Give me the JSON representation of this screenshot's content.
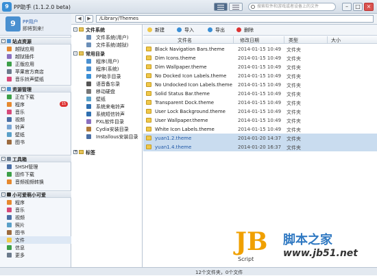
{
  "app": {
    "icon_glyph": "9",
    "title": "PP助手 (1.1.2.0 beta)"
  },
  "search": {
    "placeholder": "搜索软件和游戏或者设备上的文件"
  },
  "window_buttons": {
    "minimize": "–",
    "maximize": "□",
    "close": "×"
  },
  "profile": {
    "avatar_glyph": "9",
    "name": "PP用户",
    "slogan": "即将到来！"
  },
  "sidebar": {
    "sections": [
      {
        "label": "站点资源",
        "items": [
          {
            "label": "越狱应用"
          },
          {
            "label": "越狱插件"
          },
          {
            "label": "正版应用"
          },
          {
            "label": "苹果官方商店"
          },
          {
            "label": "音乐铃声壁纸"
          }
        ]
      },
      {
        "label": "资源管理",
        "items": [
          {
            "label": "正在下载"
          },
          {
            "label": "程序",
            "badge": "15"
          },
          {
            "label": "音乐"
          },
          {
            "label": "视频"
          },
          {
            "label": "铃声"
          },
          {
            "label": "壁纸"
          },
          {
            "label": "图书"
          }
        ]
      },
      {
        "label": "工具箱",
        "items": [
          {
            "label": "SHSH管理"
          },
          {
            "label": "固件下载"
          },
          {
            "label": "音频视频转换"
          }
        ]
      },
      {
        "label": "小可爱萌小可爱",
        "items": [
          {
            "label": "程序"
          },
          {
            "label": "音乐"
          },
          {
            "label": "视频"
          },
          {
            "label": "照片"
          },
          {
            "label": "图书"
          },
          {
            "label": "文件"
          },
          {
            "label": "信息"
          },
          {
            "label": "更多"
          }
        ]
      }
    ]
  },
  "toolbar": {
    "back": "◀",
    "forward": "▶",
    "path": "/Library/Themes"
  },
  "tree": {
    "groups": [
      {
        "label": "文件系统",
        "items": [
          {
            "label": "文件系统(用户)"
          },
          {
            "label": "文件系统(越狱)"
          }
        ]
      },
      {
        "label": "常用目录",
        "items": [
          {
            "label": "程序(用户)"
          },
          {
            "label": "程序(系统)"
          },
          {
            "label": "PP助手目录"
          },
          {
            "label": "语音备忘录"
          },
          {
            "label": "移动硬盘"
          },
          {
            "label": "壁纸"
          },
          {
            "label": "系统来电铃声"
          },
          {
            "label": "系统短信铃声"
          },
          {
            "label": "PXL软件目录"
          },
          {
            "label": "Cydia安装目录"
          },
          {
            "label": "Installous安装目录"
          }
        ]
      },
      {
        "label": "标签",
        "items": []
      }
    ]
  },
  "file_toolbar": {
    "new": "新建",
    "import": "导入",
    "export": "导出",
    "delete": "删除"
  },
  "table": {
    "headers": {
      "name": "文件名",
      "date": "修改日期",
      "type": "类型",
      "size": "大小"
    },
    "rows": [
      {
        "name": "Black Navigation Bars.theme",
        "date": "2014-01-15 10:49",
        "type": "文件夹",
        "selected": false
      },
      {
        "name": "Dim Icons.theme",
        "date": "2014-01-15 10:49",
        "type": "文件夹",
        "selected": false
      },
      {
        "name": "Dim Wallpaper.theme",
        "date": "2014-01-15 10:49",
        "type": "文件夹",
        "selected": false
      },
      {
        "name": "No Docked Icon Labels.theme",
        "date": "2014-01-15 10:49",
        "type": "文件夹",
        "selected": false
      },
      {
        "name": "No Undocked Icon Labels.theme",
        "date": "2014-01-15 10:49",
        "type": "文件夹",
        "selected": false
      },
      {
        "name": "Solid Status Bar.theme",
        "date": "2014-01-15 10:49",
        "type": "文件夹",
        "selected": false
      },
      {
        "name": "Transparent Dock.theme",
        "date": "2014-01-15 10:49",
        "type": "文件夹",
        "selected": false
      },
      {
        "name": "User Lock Background.theme",
        "date": "2014-01-15 10:49",
        "type": "文件夹",
        "selected": false
      },
      {
        "name": "User Wallpaper.theme",
        "date": "2014-01-15 10:49",
        "type": "文件夹",
        "selected": false
      },
      {
        "name": "White Icon Labels.theme",
        "date": "2014-01-15 10:49",
        "type": "文件夹",
        "selected": false
      },
      {
        "name": "yuan1.2.theme",
        "date": "2014-01-20 14:37",
        "type": "文件夹",
        "selected": true
      },
      {
        "name": "yuan1.4.theme",
        "date": "2014-01-20 16:37",
        "type": "文件夹",
        "selected": true
      }
    ]
  },
  "status": {
    "text": "12个文件夹，0个文件"
  },
  "watermark": {
    "logo": "JB",
    "script": "Script",
    "site_name": "脚本之家",
    "domain": "www.jb51.net"
  },
  "colors": {
    "accent": "#3a8fd6",
    "selection": "#c9dcef",
    "badge": "#d33333",
    "folder": "#f0c84a"
  }
}
